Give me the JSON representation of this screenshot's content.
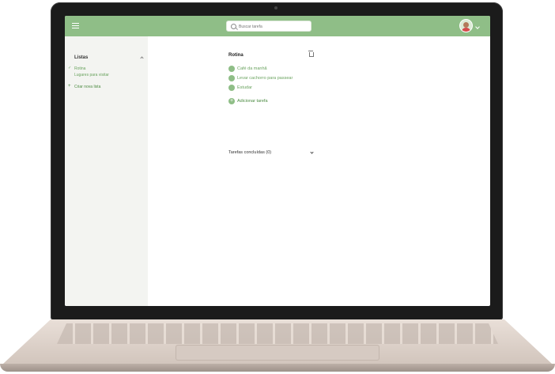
{
  "header": {
    "search_placeholder": "Buscar tarefa"
  },
  "sidebar": {
    "title": "Listas",
    "lists": [
      {
        "label": "Rotina",
        "selected": true
      },
      {
        "label": "Lugares para visitar",
        "selected": false
      }
    ],
    "create_label": "Criar nova lista"
  },
  "main": {
    "list_title": "Rotina",
    "tasks": [
      {
        "label": "Café da manhã"
      },
      {
        "label": "Levar cachorro para passear"
      },
      {
        "label": "Estudar"
      }
    ],
    "add_task_label": "Adicionar tarefa",
    "completed_label": "Tarefas concluídas (0)"
  },
  "colors": {
    "accent": "#8fbe87",
    "accent_text": "#6aa35f",
    "sidebar_bg": "#f3f4f1"
  },
  "icons": [
    "menu-icon",
    "search-icon",
    "avatar",
    "chevron-down-icon",
    "chevron-up-icon",
    "check-icon",
    "plus-icon",
    "trash-icon"
  ]
}
